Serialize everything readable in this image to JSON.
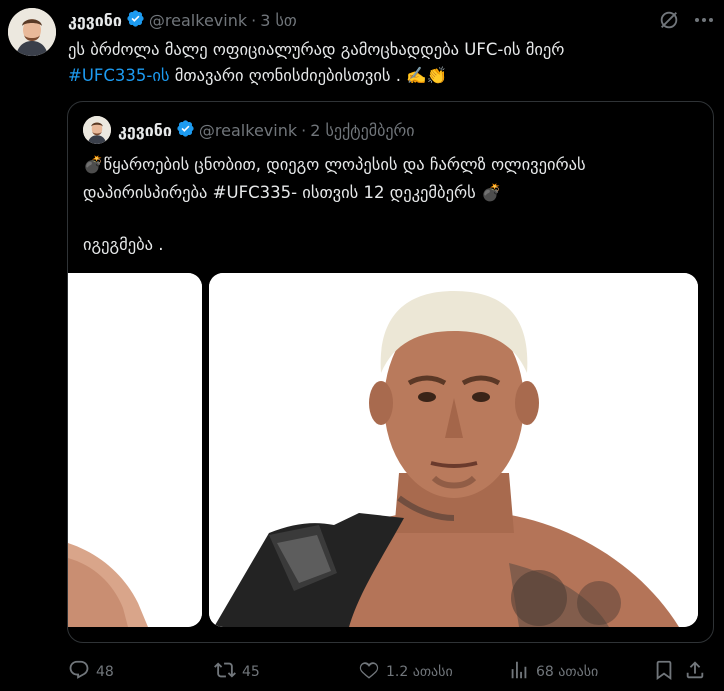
{
  "post": {
    "author_name": "კევინი",
    "handle": "@realkevink",
    "separator": "·",
    "time": "3 სთ",
    "text_line1": "ეს ბრძოლა მალე ოფიციალურად გამოცხადდება UFC-ის მიერ",
    "hashtag": "#UFC335-ის",
    "text_line2_rest": " მთავარი ღონისძიებისთვის . ✍️👏"
  },
  "quoted": {
    "author_name": "კევინი",
    "handle": "@realkevink",
    "separator": "·",
    "time": "2 სექტემბერი",
    "line1": "💣წყაროების ცნობით, დიეგო ლოპესის და ჩარლზ ოლივეირას",
    "line2": "დაპირისპირება #UFC335- ისთვის 12 დეკემბერს 💣",
    "line3": "იგეგმება ."
  },
  "actions": {
    "replies": "48",
    "reposts": "45",
    "likes": "1.2 ათასი",
    "views": "68 ათასი"
  },
  "icons": {
    "verified": "verified-badge-icon",
    "grok": "grok-icon",
    "more": "more-icon",
    "reply": "reply-icon",
    "repost": "repost-icon",
    "like": "like-icon",
    "views": "views-icon",
    "bookmark": "bookmark-icon",
    "share": "share-icon"
  },
  "colors": {
    "background": "#000000",
    "text": "#e7e9ea",
    "muted": "#71767b",
    "accent": "#1d9bf0",
    "border": "#2f3336"
  }
}
